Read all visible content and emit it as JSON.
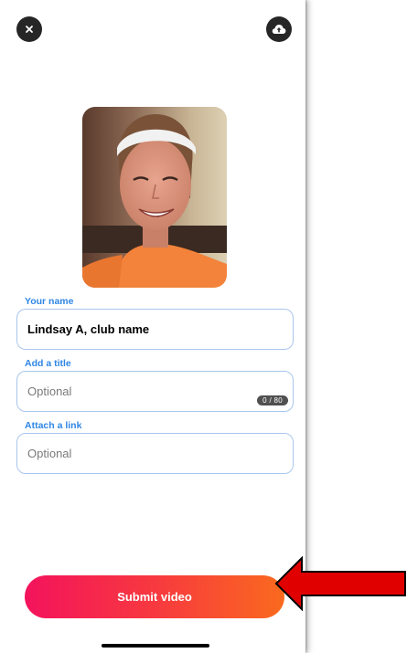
{
  "header": {
    "close_icon": "close-icon",
    "upload_icon": "cloud-upload-icon"
  },
  "preview": {
    "image": "selfie-photo"
  },
  "form": {
    "name": {
      "label": "Your name",
      "value": "Lindsay A, club name",
      "placeholder": ""
    },
    "title": {
      "label": "Add a title",
      "value": "",
      "placeholder": "Optional",
      "counter": "0 / 80"
    },
    "link": {
      "label": "Attach a link",
      "value": "",
      "placeholder": "Optional"
    }
  },
  "submit": {
    "label": "Submit video",
    "gradient_start": "#f4135c",
    "gradient_end": "#fa6a1e"
  },
  "annotation": {
    "arrow_color": "#e00000",
    "arrow_icon": "red-pointer-arrow"
  }
}
